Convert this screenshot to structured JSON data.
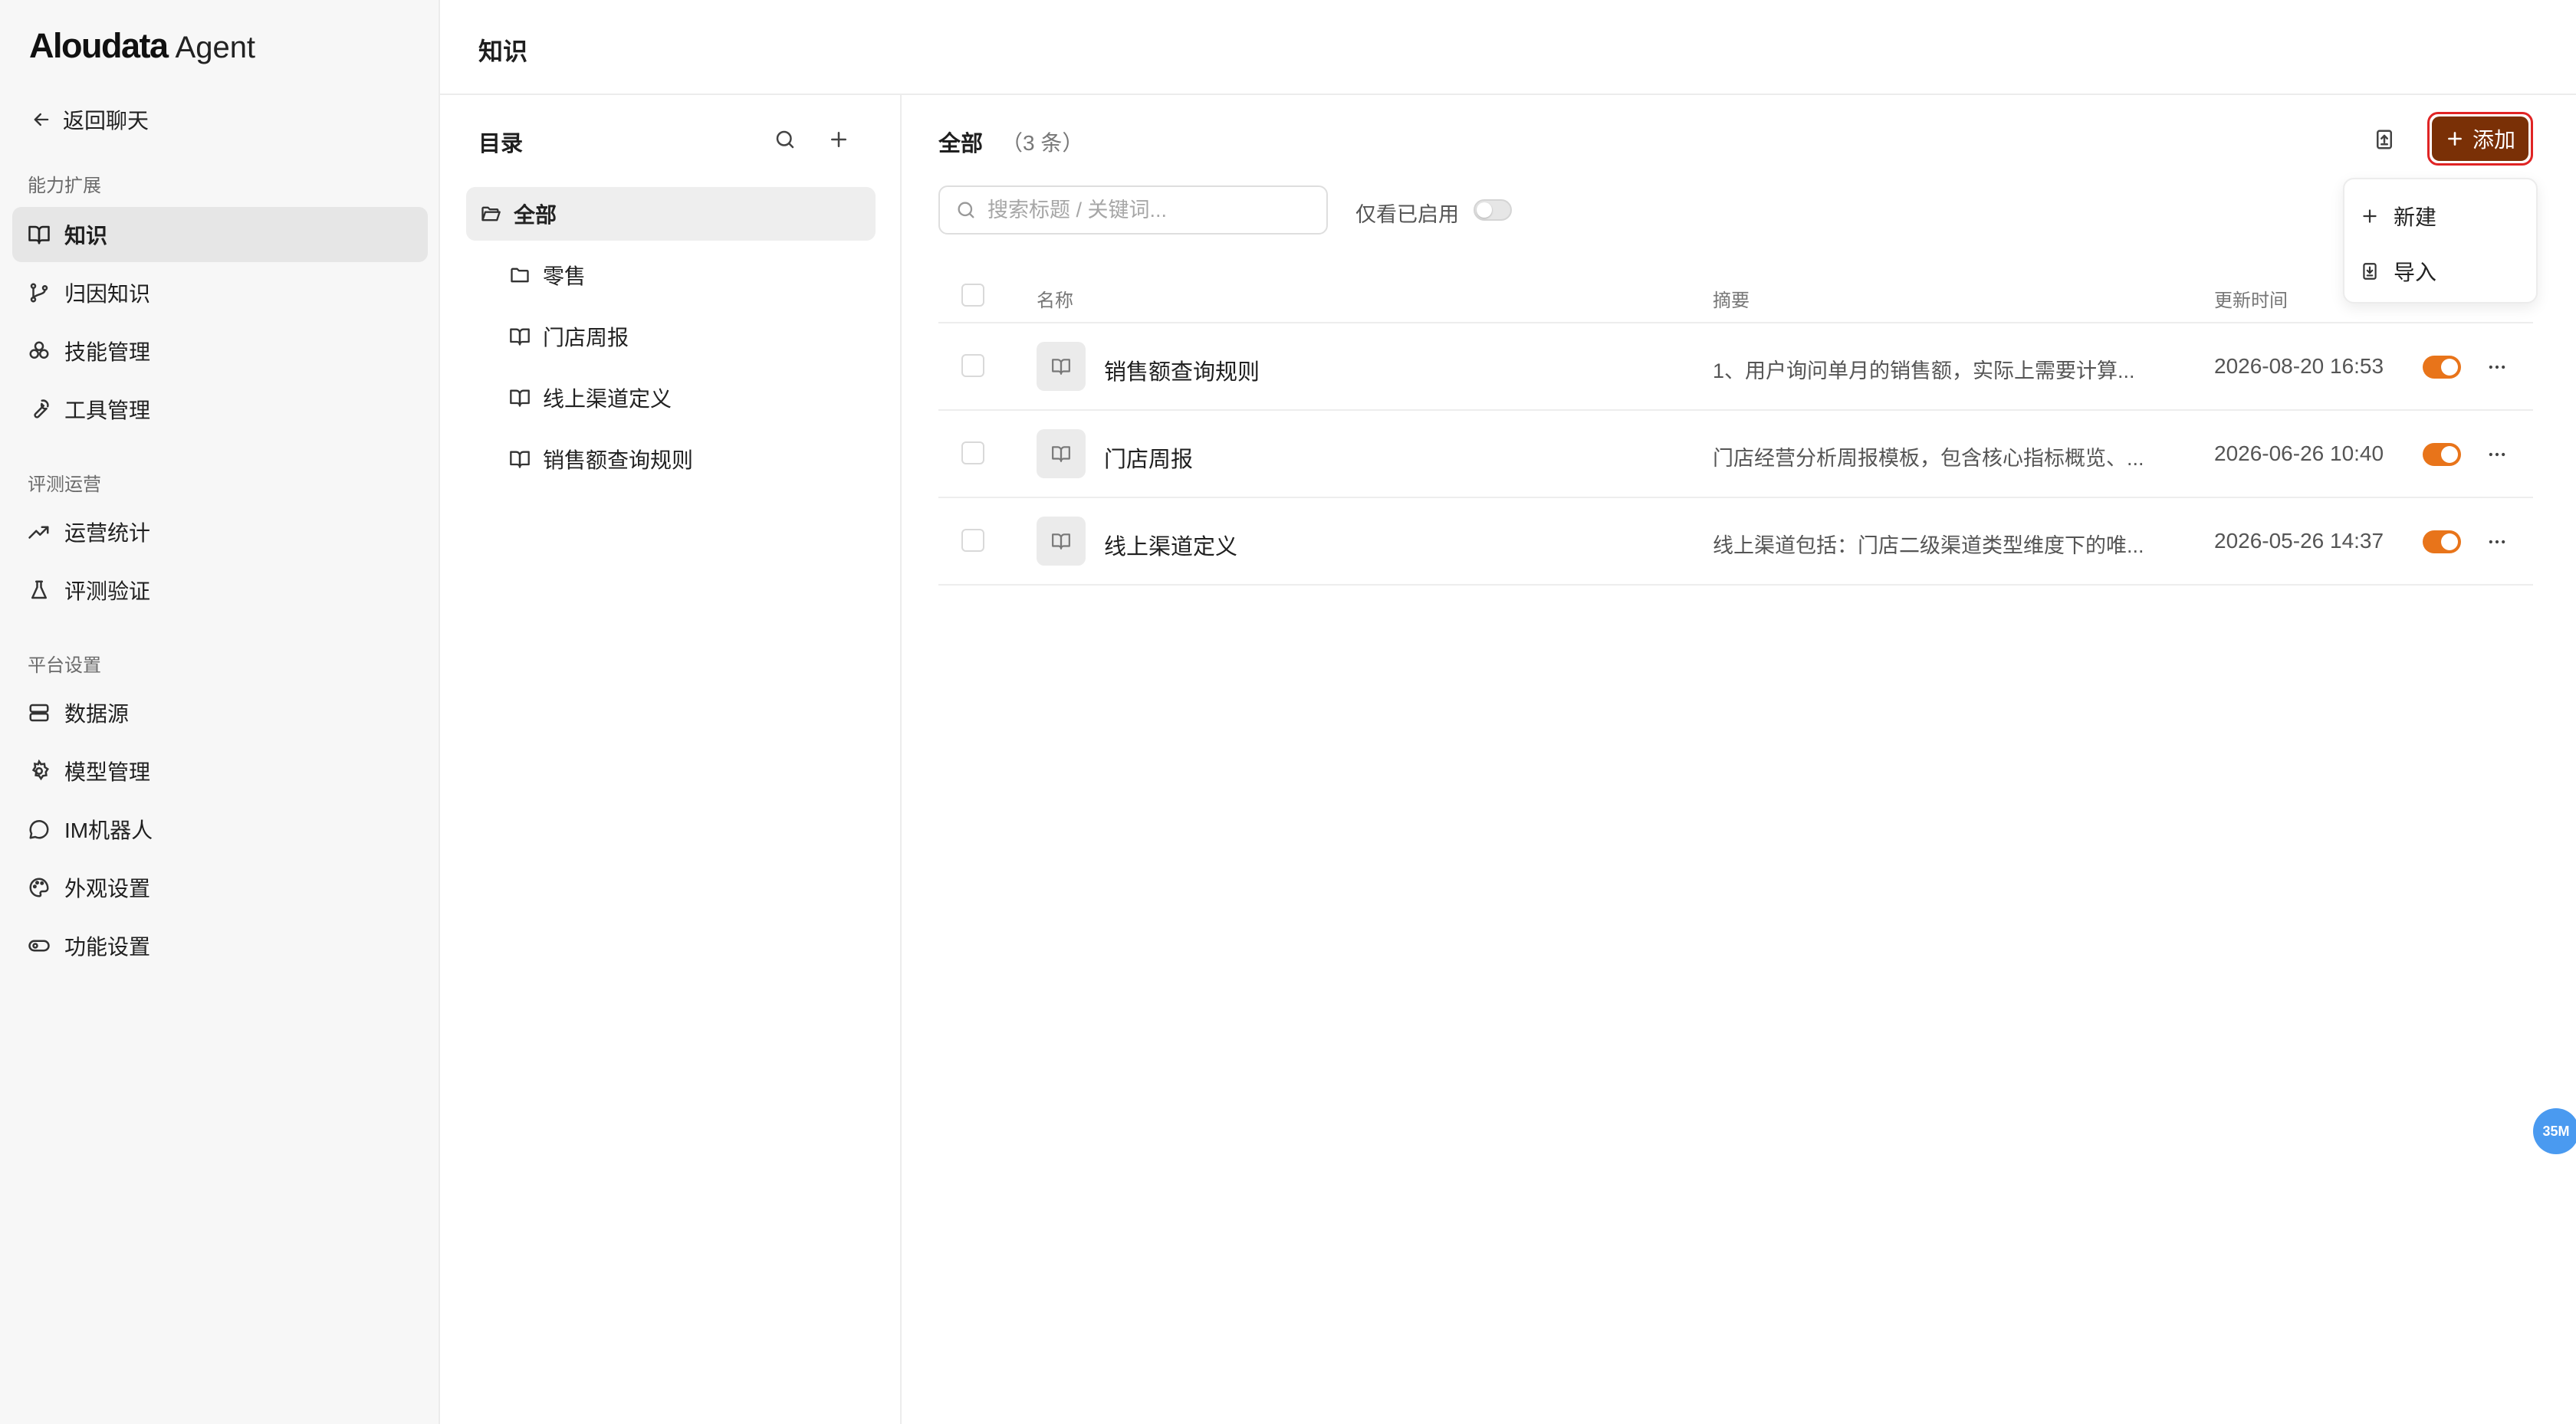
{
  "app": {
    "brand": "Aloudata",
    "product": "Agent"
  },
  "sidebar": {
    "back_label": "返回聊天",
    "sections": [
      {
        "label": "能力扩展",
        "items": [
          {
            "label": "知识",
            "icon": "book-icon",
            "active": true
          },
          {
            "label": "归因知识",
            "icon": "git-branch-icon"
          },
          {
            "label": "技能管理",
            "icon": "skills-icon"
          },
          {
            "label": "工具管理",
            "icon": "wrench-icon"
          }
        ]
      },
      {
        "label": "评测运营",
        "items": [
          {
            "label": "运营统计",
            "icon": "trending-up-icon"
          },
          {
            "label": "评测验证",
            "icon": "flask-icon"
          }
        ]
      },
      {
        "label": "平台设置",
        "items": [
          {
            "label": "数据源",
            "icon": "database-icon"
          },
          {
            "label": "模型管理",
            "icon": "gear-icon"
          },
          {
            "label": "IM机器人",
            "icon": "chat-bubble-icon"
          },
          {
            "label": "外观设置",
            "icon": "palette-icon"
          },
          {
            "label": "功能设置",
            "icon": "toggle-icon"
          }
        ]
      }
    ]
  },
  "header": {
    "title": "知识"
  },
  "directory": {
    "title": "目录",
    "root": {
      "label": "全部"
    },
    "items": [
      {
        "label": "零售",
        "icon": "folder-icon"
      },
      {
        "label": "门店周报",
        "icon": "book-icon"
      },
      {
        "label": "线上渠道定义",
        "icon": "book-icon"
      },
      {
        "label": "销售额查询规则",
        "icon": "book-icon"
      }
    ]
  },
  "main": {
    "title": "全部",
    "count": "（3 条）",
    "add_label": "添加",
    "search_placeholder": "搜索标题 / 关键词...",
    "filter_label": "仅看已启用",
    "filter_enabled": false,
    "columns": {
      "name": "名称",
      "summary": "摘要",
      "updated": "更新时间"
    },
    "rows": [
      {
        "name": "销售额查询规则",
        "summary": "1、用户询问单月的销售额，实际上需要计算...",
        "updated": "2026-08-20 16:53",
        "enabled": true
      },
      {
        "name": "门店周报",
        "summary": "门店经营分析周报模板，包含核心指标概览、...",
        "updated": "2026-06-26 10:40",
        "enabled": true
      },
      {
        "name": "线上渠道定义",
        "summary": "线上渠道包括：门店二级渠道类型维度下的唯...",
        "updated": "2026-05-26 14:37",
        "enabled": true
      }
    ],
    "add_menu": [
      {
        "label": "新建",
        "icon": "plus-icon"
      },
      {
        "label": "导入",
        "icon": "import-icon"
      }
    ]
  },
  "memory_badge": "35M",
  "colors": {
    "accent": "#7a3006",
    "toggle_on": "#e8741a",
    "highlight": "#e02424"
  }
}
